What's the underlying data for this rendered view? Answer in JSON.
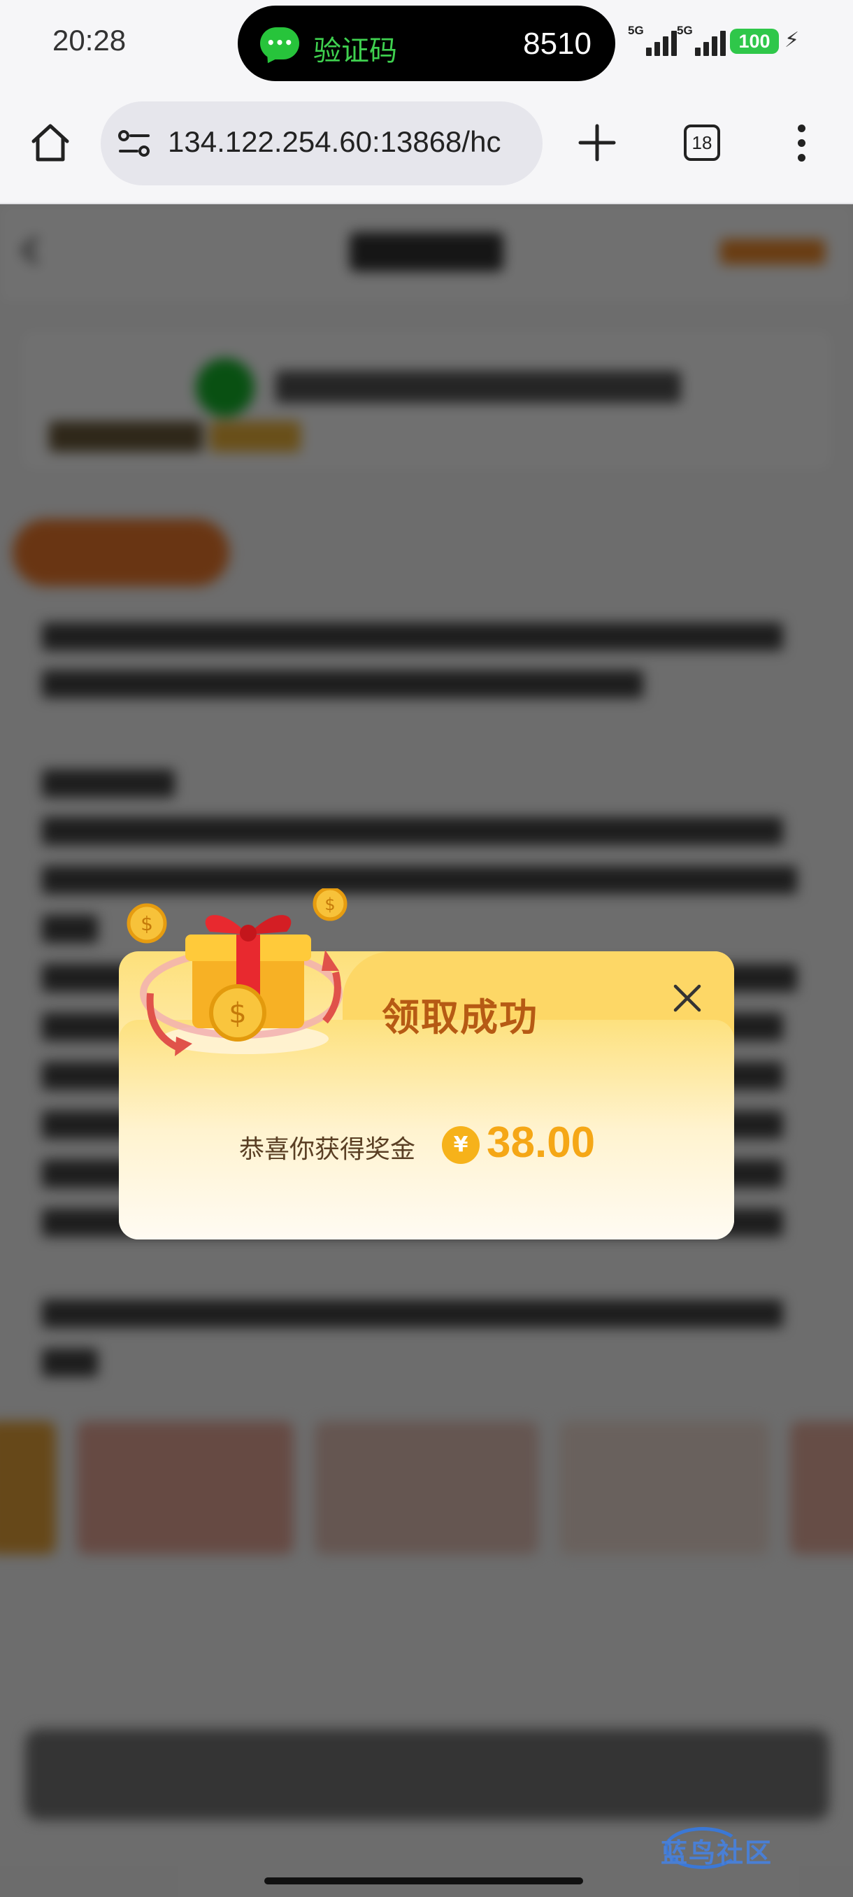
{
  "status_bar": {
    "time": "20:28",
    "island_label": "验证码",
    "island_code": "8510",
    "network_1": "5G",
    "network_2": "5G",
    "battery": "100"
  },
  "browser": {
    "url": "134.122.254.60:13868/hc",
    "tab_count": "18",
    "icons": [
      "home-icon",
      "site-settings-icon",
      "plus-icon",
      "tabs-icon",
      "more-vert-icon"
    ]
  },
  "modal": {
    "title": "领取成功",
    "message": "恭喜你获得奖金",
    "currency_symbol": "¥",
    "amount": "38.00"
  },
  "watermark": {
    "text": "蓝鸟社区"
  },
  "colors": {
    "title": "#b65a14",
    "amount": "#f5a716",
    "modal_top": "#fde07a",
    "modal_bottom": "#fffaf0"
  }
}
